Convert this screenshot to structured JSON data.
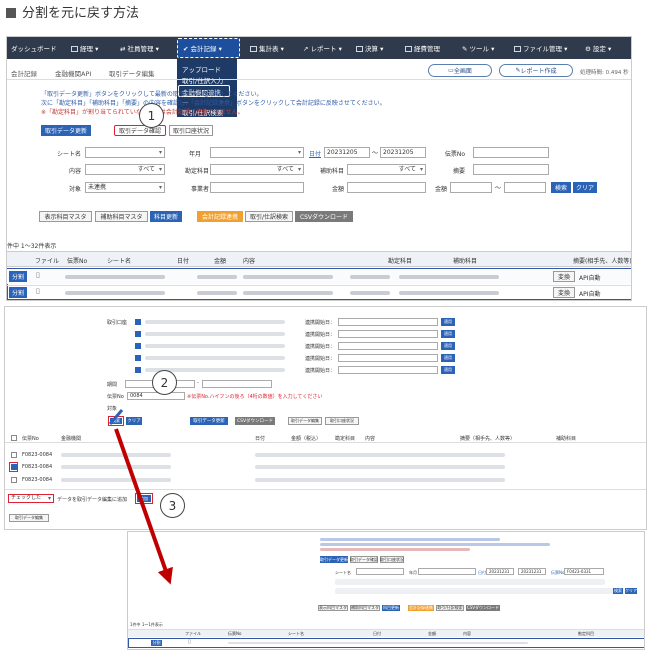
{
  "page_title": "分割を元に戻す方法",
  "nav": {
    "items": [
      "ダッシュボード",
      "経理",
      "社員管理",
      "会計記録",
      "集計表",
      "レポート",
      "決算",
      "経費管理",
      "ツール",
      "ファイル管理",
      "設定"
    ],
    "dropdown": [
      "アップロード",
      "取引/仕訳入力",
      "金融機関連携",
      "取引/仕訳検索"
    ]
  },
  "breadcrumb": [
    "会計記録",
    "金融機関API",
    "取引データ編集"
  ],
  "top_buttons": {
    "fullscreen": "全画面",
    "report": "レポート作成",
    "elapsed": "処理時間: 0.494 秒"
  },
  "info_lines": [
    "「取引データ更新」ボタンをクリックして最新の取引データを取得してください。",
    "次に「勘定科目」「補助科目」「摘要」の内容を確認し、「会計記録連携」ボタンをクリックして会計記録に反映させてください。",
    "※「勘定科目」が割り当てられていない取引は会計記録に連携できません。"
  ],
  "tabs": [
    "取引データ更新",
    "取引データ確認",
    "取引口座状況"
  ],
  "filters": {
    "sheet_label": "シート名",
    "year_label": "年月",
    "date_label": "日付",
    "date_from": "20231205",
    "date_to": "20231205",
    "slip_label": "伝票No",
    "content_label": "内容",
    "all": "すべて",
    "account_label": "勘定科目",
    "sub_label": "補助科目",
    "memo_label": "摘要",
    "target_label": "対象",
    "target_value": "未連携",
    "biz_label": "事業者",
    "amount_label": "金額",
    "amount2_label": "金額",
    "search": "検索",
    "clear": "クリア"
  },
  "action_buttons": [
    "表示科目マスタ",
    "補助科目マスタ",
    "科目更新",
    "会計記録連携",
    "取引/仕訳検索",
    "CSVダウンロード"
  ],
  "count_text": "件中 1～32件表示",
  "table": {
    "headers": [
      "ファイル",
      "伝票No",
      "シート名",
      "日付",
      "金額",
      "内容",
      "勘定科目",
      "補助科目",
      "摘要(相手先、人数等)"
    ],
    "rows": [
      {
        "btn": "分割",
        "change": "変換",
        "memo": "API自動"
      },
      {
        "btn": "分割",
        "change": "変換",
        "memo": "API自動"
      }
    ]
  },
  "step_numbers": [
    "1",
    "2",
    "3"
  ],
  "panel2": {
    "account_label": "取引口座",
    "link_label": "連携開始日：",
    "update": "適用",
    "period_label": "期間",
    "slip_label": "伝票No",
    "slip_value": "0084",
    "warning": "※伝票No.ハイフンの後ろ（4桁の数値）を入力してください",
    "target_label": "対象",
    "search": "検索",
    "clear": "クリア",
    "btn_update": "取引データ更新",
    "btn_csv": "CSVダウンロード",
    "btn_edit": "取引データ編集",
    "btn_status": "取引口座状況",
    "headers": [
      "伝票No",
      "金融機関",
      "日付",
      "金額（税込）",
      "勘定科目",
      "内容",
      "摘要（相手先、人数等）",
      "補助科目"
    ],
    "rows": [
      "F0823-0084",
      "F0823-0084",
      "F0823-0084"
    ],
    "bulk_select": "チェックした",
    "bulk_text": "データを取引データ編集に追加",
    "bulk_btn": "追加",
    "footer_btn": "取引データ編集"
  },
  "panel3": {
    "date_from": "20231231",
    "date_to": "20231231",
    "slip_value": "F0423-0331",
    "count": "1件中 1～1件表示",
    "row_btn": "分割"
  }
}
